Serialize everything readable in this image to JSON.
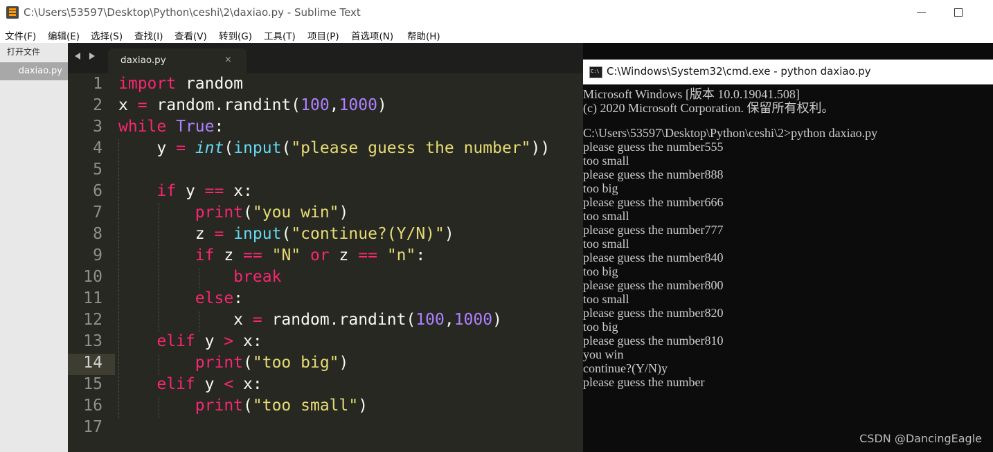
{
  "window": {
    "title": "C:\\Users\\53597\\Desktop\\Python\\ceshi\\2\\daxiao.py - Sublime Text"
  },
  "menu": [
    "文件(F)",
    "编辑(E)",
    "选择(S)",
    "查找(I)",
    "查看(V)",
    "转到(G)",
    "工具(T)",
    "项目(P)",
    "首选项(N)",
    "帮助(H)"
  ],
  "sidebar": {
    "header": "打开文件",
    "file": "daxiao.py"
  },
  "tab": {
    "label": "daxiao.py",
    "close": "×"
  },
  "editor": {
    "current_line": 14,
    "line_numbers": [
      "1",
      "2",
      "3",
      "4",
      "5",
      "6",
      "7",
      "8",
      "9",
      "10",
      "11",
      "12",
      "13",
      "14",
      "15",
      "16",
      "17"
    ],
    "lines": [
      [
        [
          "import",
          "kw"
        ],
        [
          " random",
          ""
        ]
      ],
      [
        [
          "x ",
          ""
        ],
        [
          "=",
          "kw"
        ],
        [
          " random.randint(",
          ""
        ],
        [
          "100",
          "num"
        ],
        [
          ",",
          ""
        ],
        [
          "1000",
          "num"
        ],
        [
          ")",
          ""
        ]
      ],
      [
        [
          "while",
          "kw"
        ],
        [
          " ",
          ""
        ],
        [
          "True",
          "con"
        ],
        [
          ":",
          ""
        ]
      ],
      [
        [
          "    y ",
          ""
        ],
        [
          "=",
          "kw"
        ],
        [
          " ",
          ""
        ],
        [
          "int",
          "fni"
        ],
        [
          "(",
          ""
        ],
        [
          "input",
          "fn"
        ],
        [
          "(",
          ""
        ],
        [
          "\"please guess the number\"",
          "str"
        ],
        [
          "))",
          ""
        ]
      ],
      [],
      [
        [
          "    ",
          ""
        ],
        [
          "if",
          "kw"
        ],
        [
          " y ",
          ""
        ],
        [
          "==",
          "kw"
        ],
        [
          " x:",
          ""
        ]
      ],
      [
        [
          "        ",
          ""
        ],
        [
          "print",
          "kw"
        ],
        [
          "(",
          ""
        ],
        [
          "\"you win\"",
          "str"
        ],
        [
          ")",
          ""
        ]
      ],
      [
        [
          "        z ",
          ""
        ],
        [
          "=",
          "kw"
        ],
        [
          " ",
          ""
        ],
        [
          "input",
          "fn"
        ],
        [
          "(",
          ""
        ],
        [
          "\"continue?(Y/N)\"",
          "str"
        ],
        [
          ")",
          ""
        ]
      ],
      [
        [
          "        ",
          ""
        ],
        [
          "if",
          "kw"
        ],
        [
          " z ",
          ""
        ],
        [
          "==",
          "kw"
        ],
        [
          " ",
          ""
        ],
        [
          "\"N\"",
          "str"
        ],
        [
          " ",
          ""
        ],
        [
          "or",
          "kw"
        ],
        [
          " z ",
          ""
        ],
        [
          "==",
          "kw"
        ],
        [
          " ",
          ""
        ],
        [
          "\"n\"",
          "str"
        ],
        [
          ":",
          ""
        ]
      ],
      [
        [
          "            ",
          ""
        ],
        [
          "break",
          "kw"
        ]
      ],
      [
        [
          "        ",
          ""
        ],
        [
          "else",
          "kw"
        ],
        [
          ":",
          ""
        ]
      ],
      [
        [
          "            x ",
          ""
        ],
        [
          "=",
          "kw"
        ],
        [
          " random.randint(",
          ""
        ],
        [
          "100",
          "num"
        ],
        [
          ",",
          ""
        ],
        [
          "1000",
          "num"
        ],
        [
          ")",
          ""
        ]
      ],
      [
        [
          "    ",
          ""
        ],
        [
          "elif",
          "kw"
        ],
        [
          " y ",
          ""
        ],
        [
          ">",
          "kw"
        ],
        [
          " x:",
          ""
        ]
      ],
      [
        [
          "        ",
          ""
        ],
        [
          "print",
          "kw"
        ],
        [
          "(",
          ""
        ],
        [
          "\"too big\"",
          "str"
        ],
        [
          ")",
          ""
        ]
      ],
      [
        [
          "    ",
          ""
        ],
        [
          "elif",
          "kw"
        ],
        [
          " y ",
          ""
        ],
        [
          "<",
          "kw"
        ],
        [
          " x:",
          ""
        ]
      ],
      [
        [
          "        ",
          ""
        ],
        [
          "print",
          "kw"
        ],
        [
          "(",
          ""
        ],
        [
          "\"too small\"",
          "str"
        ],
        [
          ")",
          ""
        ]
      ],
      []
    ]
  },
  "cmd": {
    "title": "C:\\Windows\\System32\\cmd.exe - python  daxiao.py",
    "lines": [
      "Microsoft Windows [版本 10.0.19041.508]",
      "(c) 2020 Microsoft Corporation. 保留所有权利。",
      "",
      "C:\\Users\\53597\\Desktop\\Python\\ceshi\\2>python daxiao.py",
      "please guess the number555",
      "too small",
      "please guess the number888",
      "too big",
      "please guess the number666",
      "too small",
      "please guess the number777",
      "too small",
      "please guess the number840",
      "too big",
      "please guess the number800",
      "too small",
      "please guess the number820",
      "too big",
      "please guess the number810",
      "you win",
      "continue?(Y/N)y",
      "please guess the number"
    ]
  },
  "watermark": "CSDN @DancingEagle",
  "colors": {
    "editor_bg": "#272822",
    "keyword": "#f92672",
    "constant": "#ae81ff",
    "string": "#e6db74",
    "function": "#66d9ef",
    "console_bg": "#0c0c0c",
    "console_text": "#cccccc"
  }
}
